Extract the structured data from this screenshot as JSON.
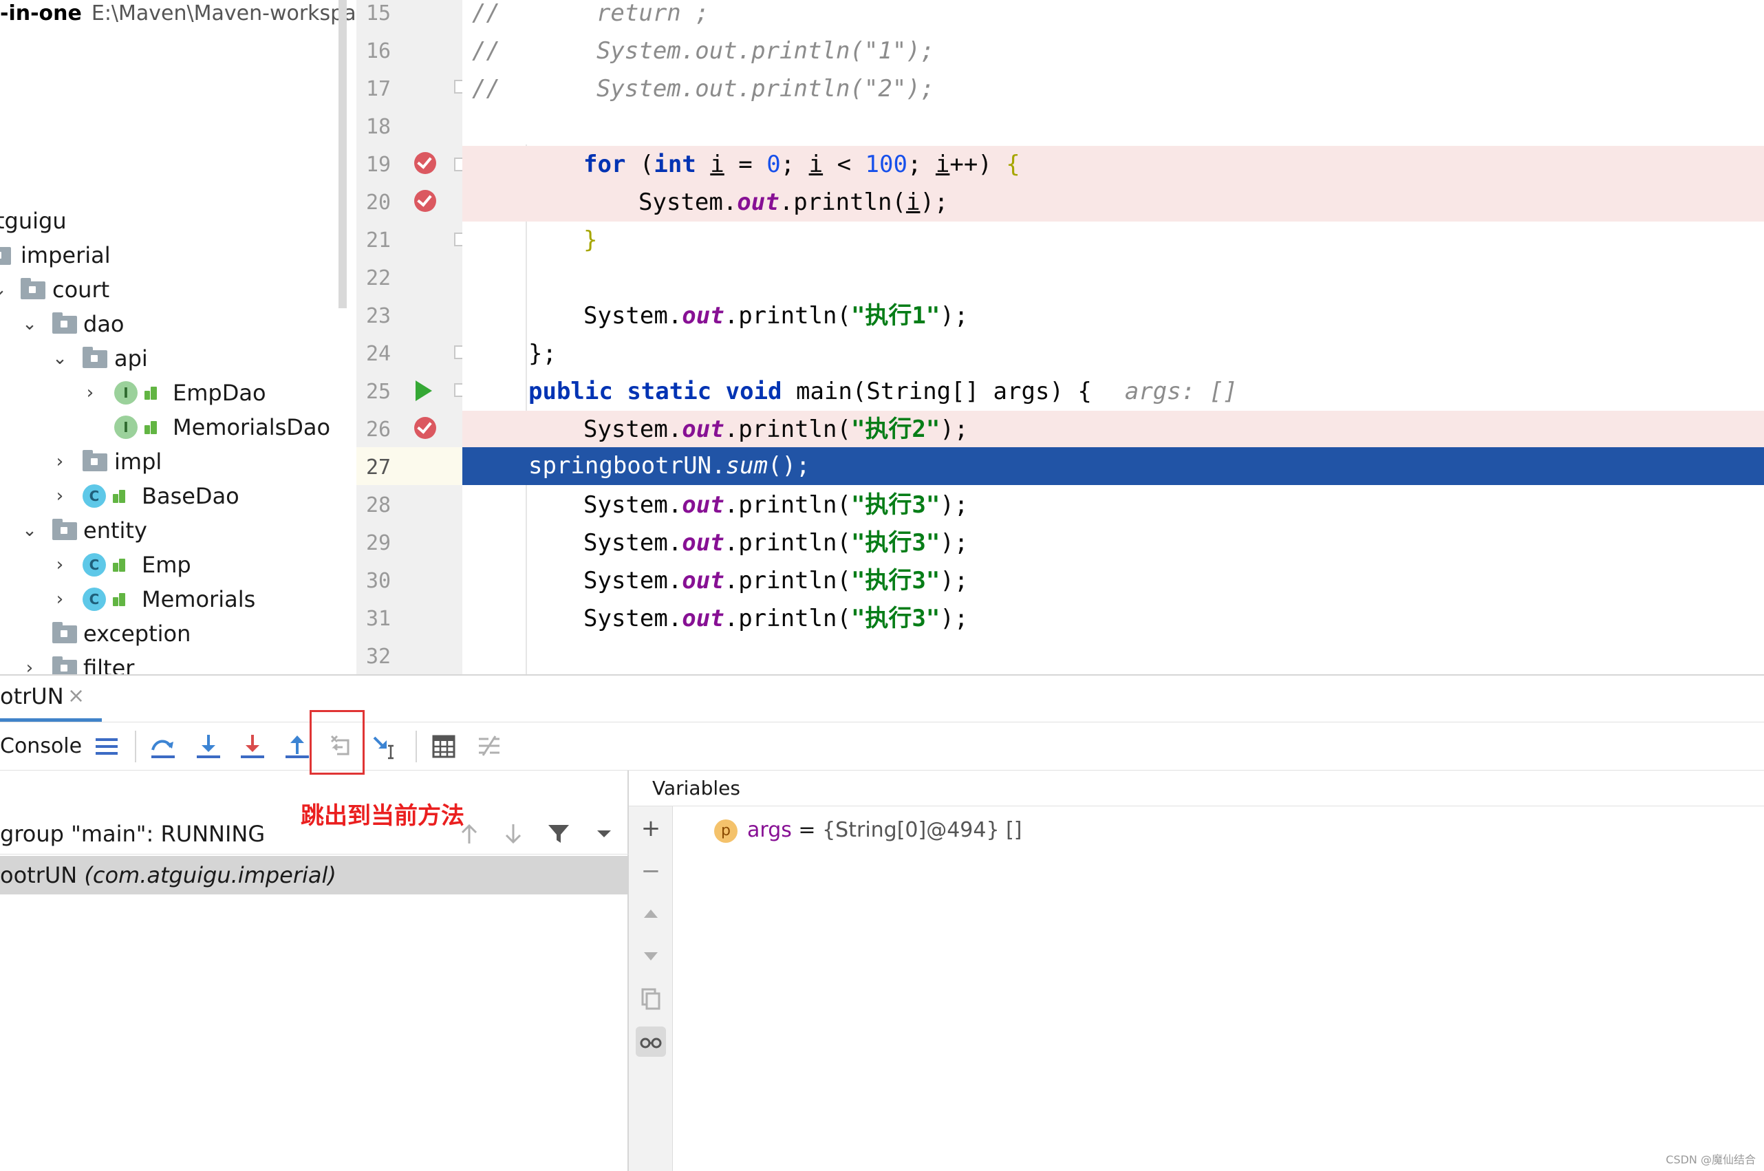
{
  "project": {
    "title_bold": "-in-one",
    "title_path": "E:\\Maven\\Maven-workspac",
    "items": [
      {
        "label": "tguigu"
      },
      {
        "label": "imperial"
      },
      {
        "label": "court"
      },
      {
        "label": "dao"
      },
      {
        "label": "api"
      },
      {
        "label": "EmpDao",
        "icon": "I"
      },
      {
        "label": "MemorialsDao",
        "icon": "I"
      },
      {
        "label": "impl"
      },
      {
        "label": "BaseDao",
        "icon": "C"
      },
      {
        "label": "entity"
      },
      {
        "label": "Emp",
        "icon": "C"
      },
      {
        "label": "Memorials",
        "icon": "C"
      },
      {
        "label": "exception"
      },
      {
        "label": "filter"
      }
    ]
  },
  "editor": {
    "line_numbers": [
      "15",
      "16",
      "17",
      "18",
      "19",
      "20",
      "21",
      "22",
      "23",
      "24",
      "25",
      "26",
      "27",
      "28",
      "29",
      "30",
      "31",
      "32"
    ],
    "current_line": "27",
    "code": {
      "l15": {
        "a": "//",
        "b": "return ;"
      },
      "l16": {
        "a": "//",
        "b": "System.out.println(\"1\");"
      },
      "l17": {
        "a": "//",
        "b": "System.out.println(\"2\");"
      },
      "l19": {
        "for": "for",
        "open": " (",
        "int": "int",
        "i1": "i",
        "eq": " = ",
        "zero": "0",
        "semi1": "; ",
        "i2": "i",
        "lt": " < ",
        "hundred": "100",
        "semi2": "; ",
        "i3": "i",
        "inc": "++) ",
        "brace": "{"
      },
      "l20": {
        "sys": "System.",
        "out": "out",
        "print": ".println(",
        "i": "i",
        "end": ");"
      },
      "l21": {
        "brace": "}"
      },
      "l23": {
        "sys": "System.",
        "out": "out",
        "print": ".println(",
        "str": "\"执行1\"",
        "end": ");"
      },
      "l24": {
        "text": "};"
      },
      "l25": {
        "public": "public",
        "static": "static",
        "void": "void",
        "sig": " main(String[] args) {",
        "hint": "args: []"
      },
      "l26": {
        "sys": "System.",
        "out": "out",
        "print": ".println(",
        "str": "\"执行2\"",
        "end": ");"
      },
      "l27": {
        "obj": "springbootrUN.",
        "method": "sum",
        "end": "();"
      },
      "l28": {
        "sys": "System.",
        "out": "out",
        "print": ".println(",
        "str": "\"执行3\"",
        "end": ");"
      },
      "l29": {
        "sys": "System.",
        "out": "out",
        "print": ".println(",
        "str": "\"执行3\"",
        "end": ");"
      },
      "l30": {
        "sys": "System.",
        "out": "out",
        "print": ".println(",
        "str": "\"执行3\"",
        "end": ");"
      },
      "l31": {
        "sys": "System.",
        "out": "out",
        "print": ".println(",
        "str": "\"执行3\"",
        "end": ");"
      }
    }
  },
  "debug": {
    "tab_title": "otrUN",
    "tab_close": "×",
    "console_label": "Console",
    "annotation": "跳出到当前方法",
    "thread_label": "group \"main\": RUNNING",
    "frame_method": "ootrUN",
    "frame_package": "(com.atguigu.imperial)",
    "variables_title": "Variables",
    "variable": {
      "icon": "p",
      "name": "args",
      "eq": " = ",
      "value": "{String[0]@494} []"
    }
  },
  "colors": {
    "breakpoint": "#db5860",
    "execution_line": "#2154a6",
    "annotation": "#ea1f1f",
    "keyword": "#0033b3",
    "string": "#067d17",
    "field": "#871094"
  },
  "watermark": "CSDN @魔仙结合"
}
